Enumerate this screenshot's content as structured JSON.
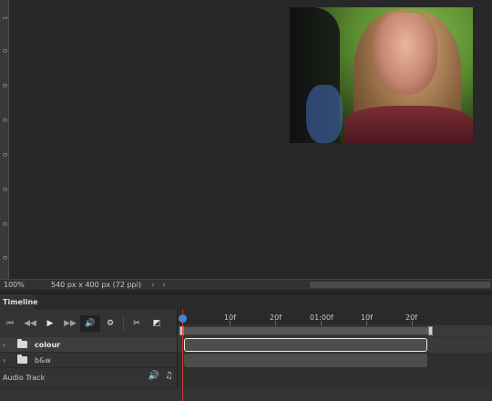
{
  "ruler": {
    "ticks": [
      "1",
      "0",
      "0",
      "0",
      "0",
      "0",
      "0",
      "0"
    ]
  },
  "status": {
    "zoom": "100%",
    "doc_info": "540 px x 400 px (72 ppi)",
    "arrow_right": "›",
    "arrow_left": "‹"
  },
  "panel": {
    "tab_label": "Timeline"
  },
  "toolbar": {
    "first_frame": "⏮",
    "prev_frame": "◀◀",
    "play": "▶",
    "next_frame": "▶▶",
    "audio": "🔊",
    "settings": "⚙",
    "split": "✂",
    "transition": "◩"
  },
  "timeline": {
    "labels": [
      "10f",
      "20f",
      "01:00f",
      "10f",
      "20f"
    ]
  },
  "layers": [
    {
      "name": "colour",
      "selected": true
    },
    {
      "name": "b&w",
      "selected": false
    }
  ],
  "audio_track": {
    "label": "Audio Track",
    "mute_icon": "🔊",
    "note_icon": "♫"
  },
  "colors": {
    "playhead": "#d63a2a",
    "knob": "#3d85d8",
    "background": "#282828"
  }
}
